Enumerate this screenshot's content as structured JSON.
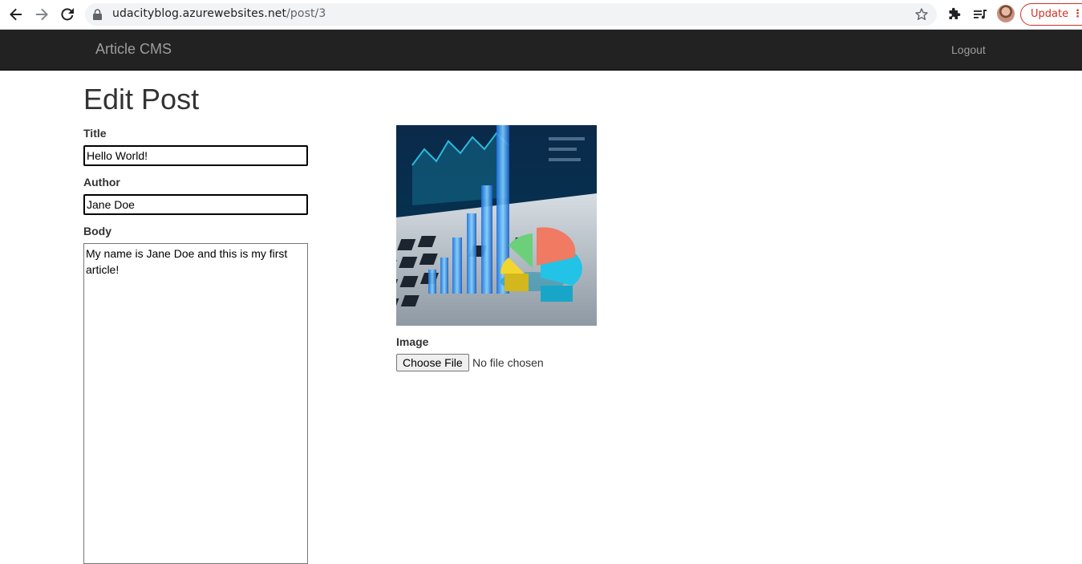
{
  "browser": {
    "url_host": "udacityblog.azurewebsites.net",
    "url_path": "/post/3",
    "update_label": "Update",
    "icons": [
      "back-icon",
      "forward-icon",
      "reload-icon",
      "lock-icon",
      "star-icon",
      "puzzle-icon",
      "media-queue-icon",
      "avatar",
      "more-icon"
    ]
  },
  "navbar": {
    "brand": "Article CMS",
    "logout": "Logout"
  },
  "form": {
    "heading": "Edit Post",
    "title_label": "Title",
    "title_value": "Hello World!",
    "author_label": "Author",
    "author_value": "Jane Doe",
    "body_label": "Body",
    "body_value": "My name is Jane Doe and this is my first article!",
    "image_label": "Image",
    "choose_file_label": "Choose File",
    "file_status": "No file chosen"
  },
  "colors": {
    "navbar_bg": "#222222",
    "navbar_text": "#9d9d9d",
    "update_red": "#d93025"
  }
}
